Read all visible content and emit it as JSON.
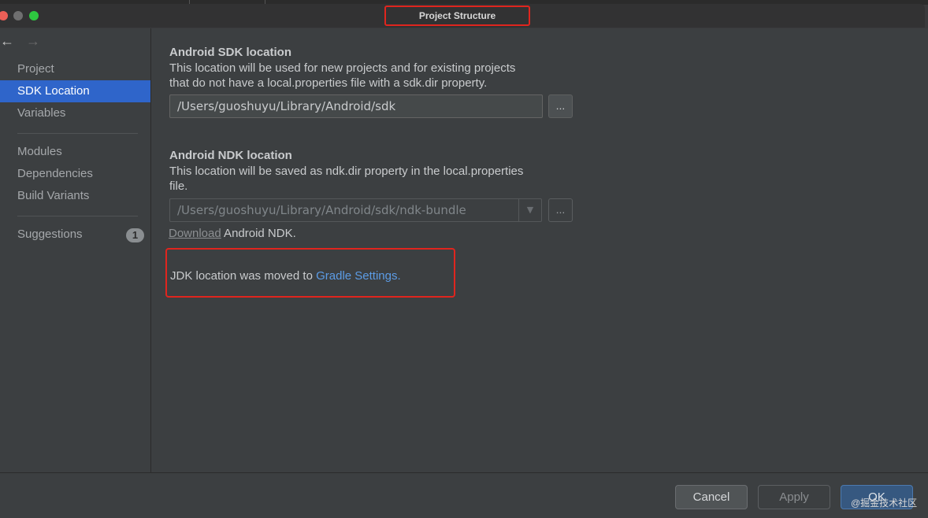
{
  "window": {
    "title": "Project Structure"
  },
  "sidebar": {
    "back_icon": "←",
    "forward_icon": "→",
    "items": [
      {
        "label": "Project",
        "selected": false
      },
      {
        "label": "SDK Location",
        "selected": true
      },
      {
        "label": "Variables",
        "selected": false
      },
      {
        "label": "Modules",
        "selected": false
      },
      {
        "label": "Dependencies",
        "selected": false
      },
      {
        "label": "Build Variants",
        "selected": false
      },
      {
        "label": "Suggestions",
        "selected": false,
        "badge": "1"
      }
    ]
  },
  "sdk": {
    "title": "Android SDK location",
    "desc_line1": "This location will be used for new projects and for existing projects",
    "desc_line2": "that do not have a local.properties file with a sdk.dir property.",
    "path": "/Users/guoshuyu/Library/Android/sdk",
    "browse_label": "..."
  },
  "ndk": {
    "title": "Android NDK location",
    "desc_line1": "This location will be saved as ndk.dir property in the local.properties",
    "desc_line2": "file.",
    "path": "/Users/guoshuyu/Library/Android/sdk/ndk-bundle",
    "browse_label": "...",
    "combo_arrow": "▼",
    "download_link": "Download",
    "download_suffix": " Android NDK."
  },
  "jdk": {
    "text": "JDK location was moved to ",
    "link": "Gradle Settings."
  },
  "footer": {
    "cancel_label": "Cancel",
    "apply_label": "Apply",
    "ok_label": "OK"
  },
  "watermark": "@掘金技术社区",
  "colors": {
    "accent": "#2f65ca",
    "link": "#5c9ce6",
    "highlight_box": "#e0251e"
  }
}
